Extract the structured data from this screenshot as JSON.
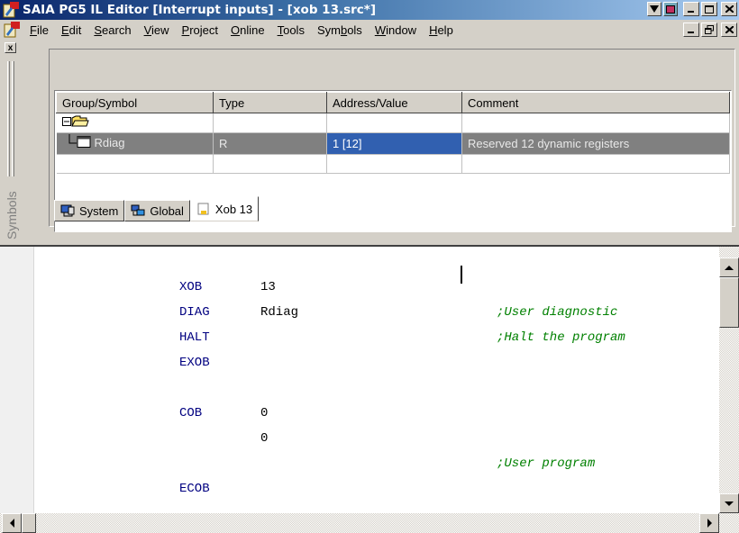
{
  "window": {
    "title": "SAIA PG5 IL Editor [Interrupt inputs] - [xob 13.src*]",
    "controls": [
      "_",
      "□",
      "X"
    ]
  },
  "menu": {
    "items": [
      {
        "label": "File",
        "key": "F"
      },
      {
        "label": "Edit",
        "key": "E"
      },
      {
        "label": "Search",
        "key": "S"
      },
      {
        "label": "View",
        "key": "V"
      },
      {
        "label": "Project",
        "key": "P"
      },
      {
        "label": "Online",
        "key": "O"
      },
      {
        "label": "Tools",
        "key": "T"
      },
      {
        "label": "Symbols",
        "key": "b"
      },
      {
        "label": "Window",
        "key": "W"
      },
      {
        "label": "Help",
        "key": "H"
      }
    ]
  },
  "symbols_panel": {
    "dock_label": "Symbols",
    "columns": [
      "Group/Symbol",
      "Type",
      "Address/Value",
      "Comment"
    ],
    "rows": [
      {
        "symbol": "Rdiag",
        "type": "R",
        "address": "1 [12]",
        "comment": "Reserved 12 dynamic registers"
      }
    ],
    "tabs": [
      {
        "label": "System",
        "icon": "system-icon"
      },
      {
        "label": "Global",
        "icon": "global-icon"
      },
      {
        "label": "Xob 13",
        "icon": "file-icon"
      }
    ]
  },
  "editor": {
    "lines": [
      {
        "instr": "XOB",
        "operand": "13",
        "comment": ""
      },
      {
        "instr": "DIAG",
        "operand": "Rdiag",
        "comment": ";User diagnostic"
      },
      {
        "instr": "HALT",
        "operand": "",
        "comment": ";Halt the program"
      },
      {
        "instr": "EXOB",
        "operand": "",
        "comment": ""
      },
      {
        "instr": "COB",
        "operand": "0",
        "comment": ""
      },
      {
        "instr": "",
        "operand": "0",
        "comment": ""
      },
      {
        "instr": "",
        "operand": "",
        "comment": ";User program"
      },
      {
        "instr": "ECOB",
        "operand": "",
        "comment": ""
      }
    ]
  },
  "colors": {
    "keyword": "#000080",
    "comment": "#008000",
    "selection": "#3160b0",
    "titlebar": "#0a246a"
  }
}
